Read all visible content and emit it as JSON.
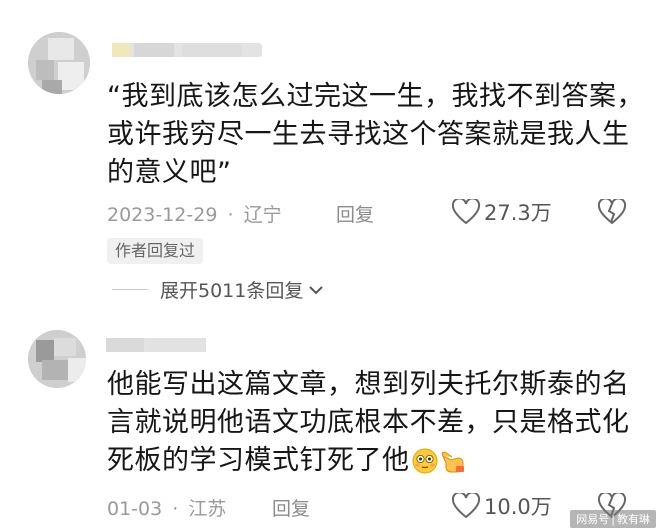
{
  "comments": [
    {
      "text": "“我到底该怎么过完这一生，我找不到答案，或许我穷尽一生去寻找这个答案就是我人生的意义吧”",
      "date": "2023-12-29",
      "separator": "·",
      "location": "辽宁",
      "reply_label": "回复",
      "likes": "27.3万",
      "author_badge": "作者回复过",
      "expand_label": "展开5011条回复"
    },
    {
      "text": "他能写出这篇文章，想到列夫托尔斯泰的名言就说明他语文功底根本不差，只是格式化死板的学习模式钉死了他",
      "date": "01-03",
      "separator": "·",
      "location": "江苏",
      "reply_label": "回复",
      "likes": "10.0万"
    }
  ],
  "icons": {
    "heart": "heart-outline-icon",
    "broken_heart": "broken-heart-icon",
    "chevron": "chevron-down-icon",
    "emoji1": "flushed-face-emoji-icon",
    "emoji2": "pointing-hand-emoji-icon"
  },
  "watermark": {
    "left": "网易号",
    "right": "教有琳"
  },
  "colors": {
    "text": "#161616",
    "meta": "#9a9a9a",
    "badge_bg": "#f0f0f0"
  }
}
